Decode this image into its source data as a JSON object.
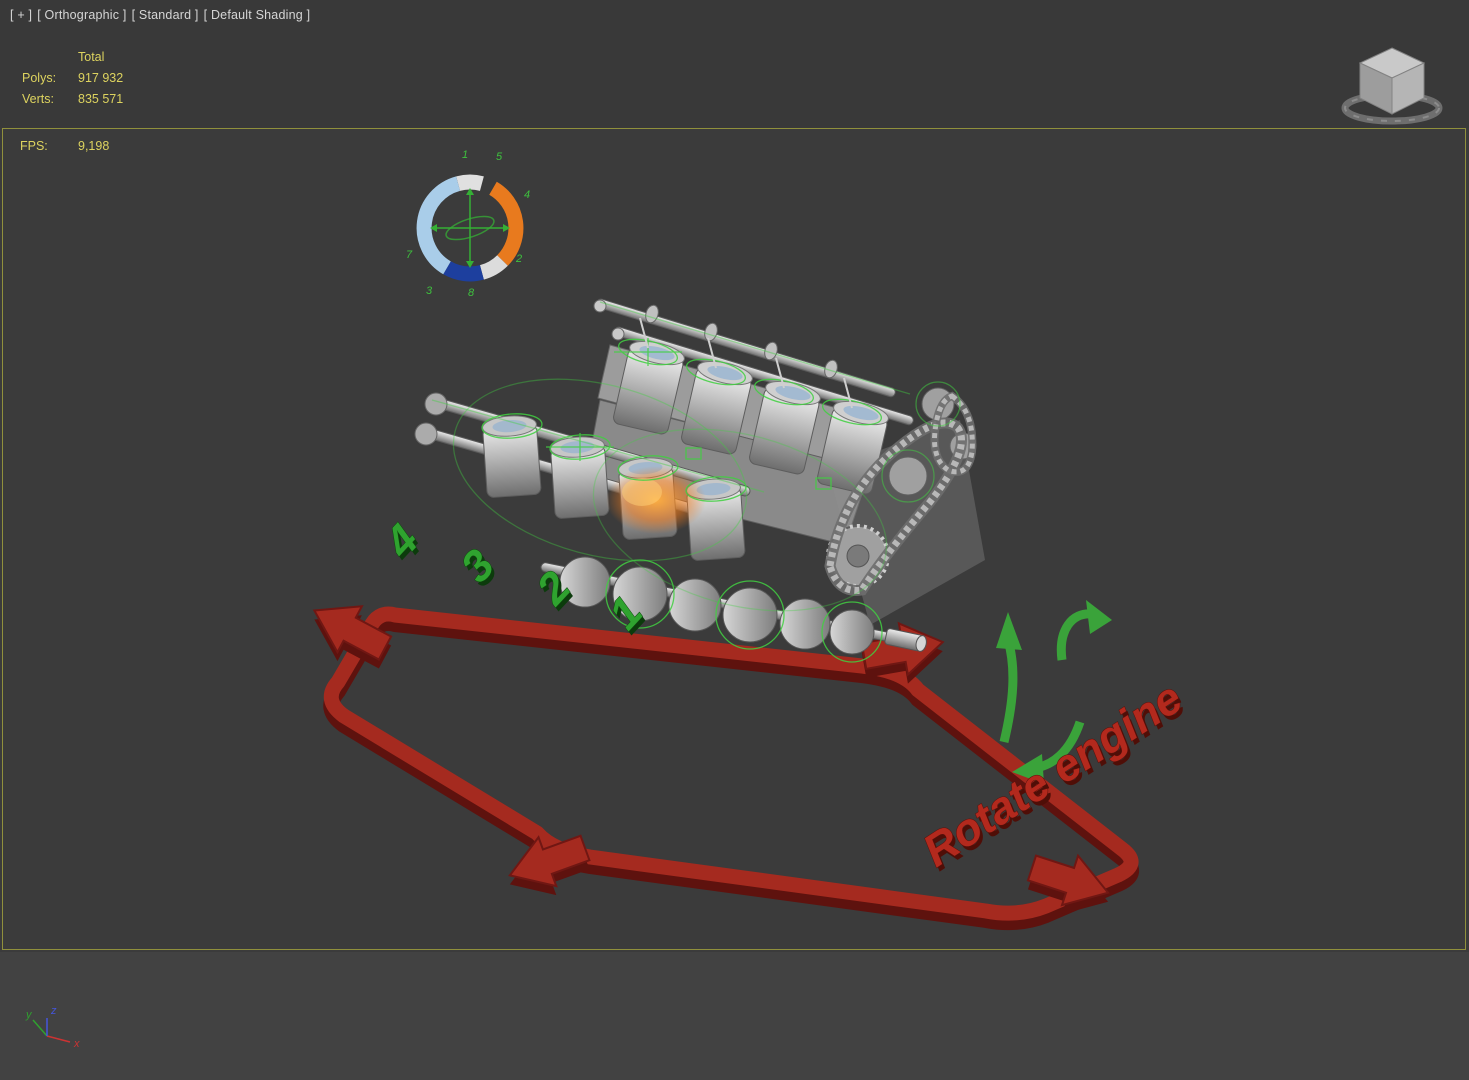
{
  "viewport": {
    "label": {
      "plus": "[ + ]",
      "projection": "[ Orthographic ]",
      "style": "[ Standard ]",
      "shading": "[ Default Shading ]"
    },
    "border_color": "#90903c"
  },
  "stats": {
    "total_label": "Total",
    "polys_label": "Polys:",
    "polys_value": "917 932",
    "verts_label": "Verts:",
    "verts_value": "835 571",
    "fps_label": "FPS:",
    "fps_value": "9,198",
    "text_color": "#ddd35f"
  },
  "scene": {
    "rotate_engine_label": "Rotate engine",
    "ground_numbers": [
      "4",
      "3",
      "2",
      "1"
    ],
    "wheel_numbers": [
      "1",
      "5",
      "4",
      "2",
      "8",
      "3",
      "7"
    ],
    "colors": {
      "gizmo_red": "#a52a1f",
      "gizmo_green": "#3aa33a",
      "wireframe_green": "#41d041",
      "wheel_orange": "#e87a1e",
      "wheel_lightblue": "#a9cde9",
      "wheel_navy": "#1d3f9e",
      "glow_orange": "#f07818"
    }
  },
  "axis_gizmo": {
    "x_label": "x",
    "y_label": "y",
    "z_label": "z"
  }
}
